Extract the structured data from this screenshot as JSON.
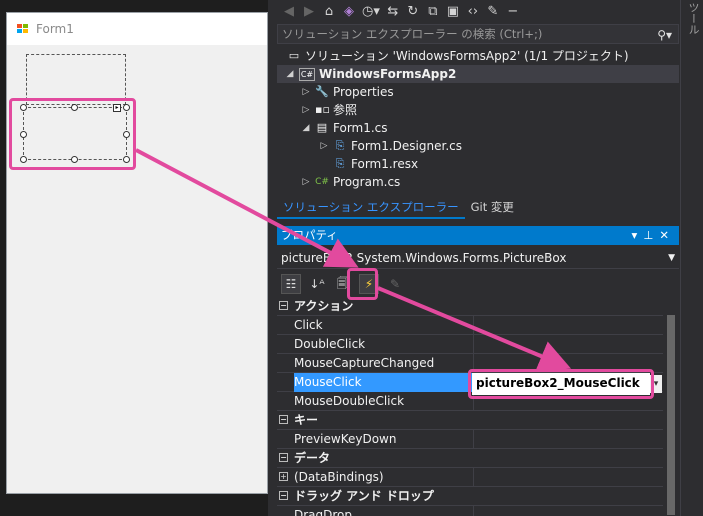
{
  "designer": {
    "form_title": "Form1"
  },
  "toolbar": {
    "icons": [
      "back-icon",
      "forward-icon",
      "home-icon",
      "vs-icon",
      "history-icon",
      "sync-icon",
      "refresh-icon",
      "copy-icon",
      "code-icon",
      "wrench-icon",
      "minus-icon"
    ]
  },
  "right_edge_tab": "ツール",
  "solution_explorer": {
    "search_placeholder": "ソリューション エクスプローラー の検索 (Ctrl+;)",
    "solution_label": "ソリューション 'WindowsFormsApp2' (1/1 プロジェクト)",
    "project_label": "WindowsFormsApp2",
    "items": [
      {
        "label": "Properties",
        "icon": "wrench-icon"
      },
      {
        "label": "参照",
        "icon": "references-icon"
      },
      {
        "label": "Form1.cs",
        "icon": "form-icon"
      },
      {
        "label": "Form1.Designer.cs",
        "icon": "cs-file-icon"
      },
      {
        "label": "Form1.resx",
        "icon": "resx-icon"
      },
      {
        "label": "Program.cs",
        "icon": "csharp-icon"
      }
    ],
    "project_icon_text": "C#",
    "program_icon_text": "C#"
  },
  "tabs": [
    {
      "label": "ソリューション エクスプローラー"
    },
    {
      "label": "Git 変更"
    }
  ],
  "properties": {
    "header": "プロパティ",
    "object_selector": "pictureBox2  System.Windows.Forms.PictureBox",
    "rows": [
      {
        "name": "アクション",
        "category": true
      },
      {
        "name": "Click"
      },
      {
        "name": "DoubleClick"
      },
      {
        "name": "MouseCaptureChanged"
      },
      {
        "name": "MouseClick",
        "selected": true,
        "value": "pictureBox2_MouseClick"
      },
      {
        "name": "MouseDoubleClick"
      },
      {
        "name": "キー",
        "category": true
      },
      {
        "name": "PreviewKeyDown"
      },
      {
        "name": "データ",
        "category": true
      },
      {
        "name": "(DataBindings)",
        "collapsed": true
      },
      {
        "name": "ドラッグ アンド ドロップ",
        "category": true
      },
      {
        "name": "DragDrop"
      }
    ]
  },
  "colors": {
    "highlight": "#e24a9e",
    "accent": "#007acc",
    "selection": "#3399ff"
  }
}
